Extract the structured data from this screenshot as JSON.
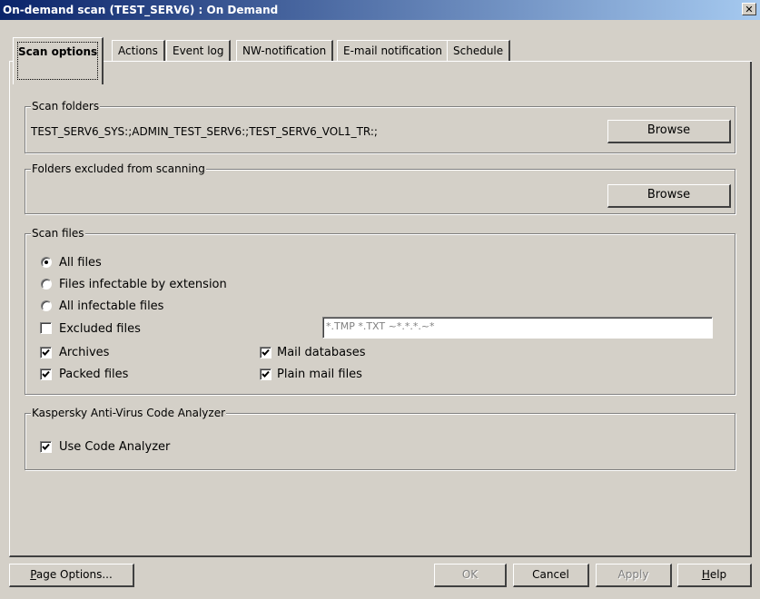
{
  "window": {
    "title": "On-demand scan (TEST_SERV6) : On Demand",
    "close_glyph": "✕"
  },
  "tabs": [
    {
      "label": "Scan options",
      "active": true
    },
    {
      "label": "Actions"
    },
    {
      "label": "Event log"
    },
    {
      "label": "NW-notification"
    },
    {
      "label": "E-mail notification"
    },
    {
      "label": "Schedule"
    }
  ],
  "scan_folders": {
    "label": "Scan folders",
    "value": "TEST_SERV6_SYS:;ADMIN_TEST_SERV6:;TEST_SERV6_VOL1_TR:;",
    "browse_label": "Browse"
  },
  "excluded_folders": {
    "label": "Folders excluded from scanning",
    "value": "",
    "browse_label": "Browse"
  },
  "scan_files": {
    "label": "Scan files",
    "radios": [
      {
        "label": "All files",
        "selected": true
      },
      {
        "label": "Files infectable by extension",
        "selected": false
      },
      {
        "label": "All infectable files",
        "selected": false
      }
    ],
    "excluded": {
      "label": "Excluded files",
      "checked": false,
      "mask_value": "*.TMP *.TXT ~*.*.*.~*"
    },
    "archives": {
      "label": "Archives",
      "checked": true
    },
    "packed": {
      "label": "Packed files",
      "checked": true
    },
    "mail_db": {
      "label": "Mail databases",
      "checked": true
    },
    "plain_mail": {
      "label": "Plain mail files",
      "checked": true
    }
  },
  "code_analyzer": {
    "label": "Kaspersky Anti-Virus Code Analyzer",
    "use": {
      "label": "Use Code Analyzer",
      "checked": true
    }
  },
  "footer": {
    "page_options_first": "P",
    "page_options_rest": "age Options...",
    "ok": "OK",
    "cancel": "Cancel",
    "apply": "Apply",
    "help_first": "H",
    "help_rest": "elp"
  }
}
